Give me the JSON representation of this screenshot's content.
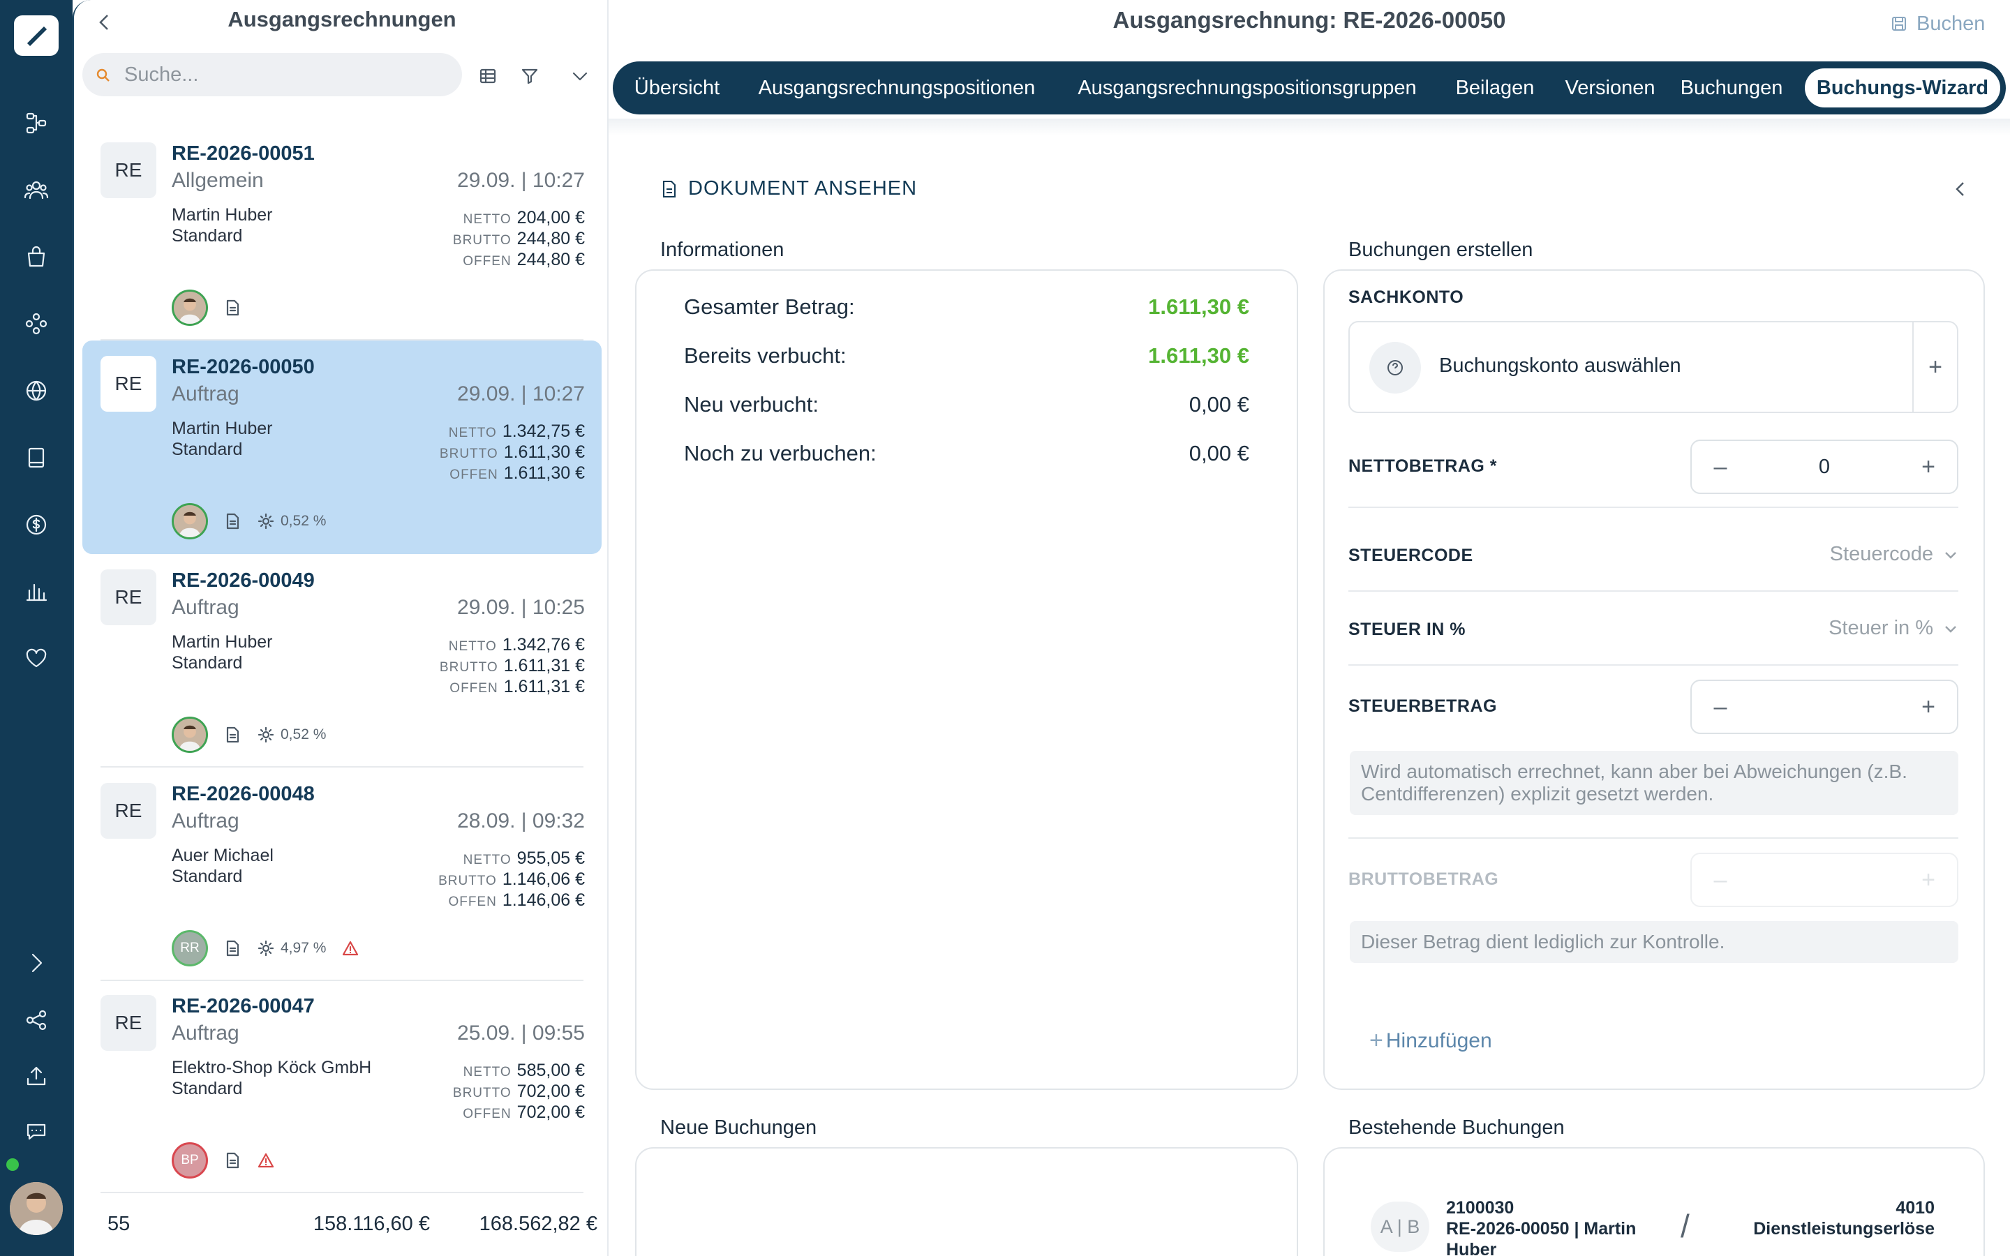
{
  "list_panel": {
    "title": "Ausgangsrechnungen",
    "search_placeholder": "Suche...",
    "cards": [
      {
        "badge": "RE",
        "number": "RE-2026-00051",
        "kind": "Allgemein",
        "date": "29.09. | 10:27",
        "customer": "Martin Huber",
        "category": "Standard",
        "netto_label": "NETTO",
        "netto": "204,00 €",
        "brutto_label": "BRUTTO",
        "brutto": "244,80 €",
        "offen_label": "OFFEN",
        "offen": "244,80 €",
        "percent": "",
        "avatar": "",
        "selected": false
      },
      {
        "badge": "RE",
        "number": "RE-2026-00050",
        "kind": "Auftrag",
        "date": "29.09. | 10:27",
        "customer": "Martin Huber",
        "category": "Standard",
        "netto_label": "NETTO",
        "netto": "1.342,75 €",
        "brutto_label": "BRUTTO",
        "brutto": "1.611,30 €",
        "offen_label": "OFFEN",
        "offen": "1.611,30 €",
        "percent": "0,52 %",
        "avatar": "",
        "selected": true
      },
      {
        "badge": "RE",
        "number": "RE-2026-00049",
        "kind": "Auftrag",
        "date": "29.09. | 10:25",
        "customer": "Martin Huber",
        "category": "Standard",
        "netto_label": "NETTO",
        "netto": "1.342,76 €",
        "brutto_label": "BRUTTO",
        "brutto": "1.611,31 €",
        "offen_label": "OFFEN",
        "offen": "1.611,31 €",
        "percent": "0,52 %",
        "avatar": "",
        "selected": false
      },
      {
        "badge": "RE",
        "number": "RE-2026-00048",
        "kind": "Auftrag",
        "date": "28.09. | 09:32",
        "customer": "Auer Michael",
        "category": "Standard",
        "netto_label": "NETTO",
        "netto": "955,05 €",
        "brutto_label": "BRUTTO",
        "brutto": "1.146,06 €",
        "offen_label": "OFFEN",
        "offen": "1.146,06 €",
        "percent": "4,97 %",
        "avatar": "RR",
        "selected": false
      },
      {
        "badge": "RE",
        "number": "RE-2026-00047",
        "kind": "Auftrag",
        "date": "25.09. | 09:55",
        "customer": "Elektro-Shop Köck GmbH",
        "category": "Standard",
        "netto_label": "NETTO",
        "netto": "585,00 €",
        "brutto_label": "BRUTTO",
        "brutto": "702,00 €",
        "offen_label": "OFFEN",
        "offen": "702,00 €",
        "percent": "",
        "avatar": "BP",
        "selected": false
      }
    ],
    "footer": {
      "count": "55",
      "sum_netto": "158.116,60 €",
      "sum_brutto": "168.562,82 €"
    }
  },
  "header": {
    "title": "Ausgangsrechnung: RE-2026-00050",
    "buchen_label": "Buchen"
  },
  "tabs": [
    "Übersicht",
    "Ausgangsrechnungspositionen",
    "Ausgangsrechnungspositionsgruppen",
    "Beilagen",
    "Versionen",
    "Buchungen",
    "Buchungs-Wizard"
  ],
  "active_tab": "Buchungs-Wizard",
  "doc_link": "DOKUMENT ANSEHEN",
  "info": {
    "heading": "Informationen",
    "rows": [
      {
        "label": "Gesamter Betrag:",
        "value": "1.611,30 €",
        "highlight": true
      },
      {
        "label": "Bereits verbucht:",
        "value": "1.611,30 €",
        "highlight": true
      },
      {
        "label": "Neu verbucht:",
        "value": "0,00 €",
        "highlight": false
      },
      {
        "label": "Noch zu verbuchen:",
        "value": "0,00 €",
        "highlight": false
      }
    ]
  },
  "form": {
    "heading": "Buchungen erstellen",
    "sachkonto_label": "SACHKONTO",
    "sachkonto_placeholder": "Buchungskonto auswählen",
    "netto_label": "NETTOBETRAG *",
    "netto_value": "0",
    "steuercode_label": "STEUERCODE",
    "steuercode_placeholder": "Steuercode",
    "steuer_pct_label": "STEUER IN %",
    "steuer_pct_placeholder": "Steuer in %",
    "steuerbetrag_label": "STEUERBETRAG",
    "steuerbetrag_value": "",
    "steuerbetrag_hint": "Wird automatisch errechnet, kann aber bei Abweichungen (z.B. Centdifferenzen) explizit gesetzt werden.",
    "brutto_label": "BRUTTOBETRAG",
    "brutto_hint": "Dieser Betrag dient lediglich zur Kontrolle.",
    "add_label": "Hinzufügen"
  },
  "new_bookings": {
    "heading": "Neue Buchungen"
  },
  "existing_bookings": {
    "heading": "Bestehende Buchungen",
    "items": [
      {
        "ab": "A | B",
        "account": "2100030",
        "text": "RE-2026-00050 | Martin Huber",
        "counter_account": "4010",
        "counter_text": "Dienstleistungserlöse"
      }
    ]
  },
  "colors": {
    "navy": "#123a55",
    "selected_card": "#bfdcf5",
    "positive": "#55b433",
    "warning": "#d94747"
  }
}
